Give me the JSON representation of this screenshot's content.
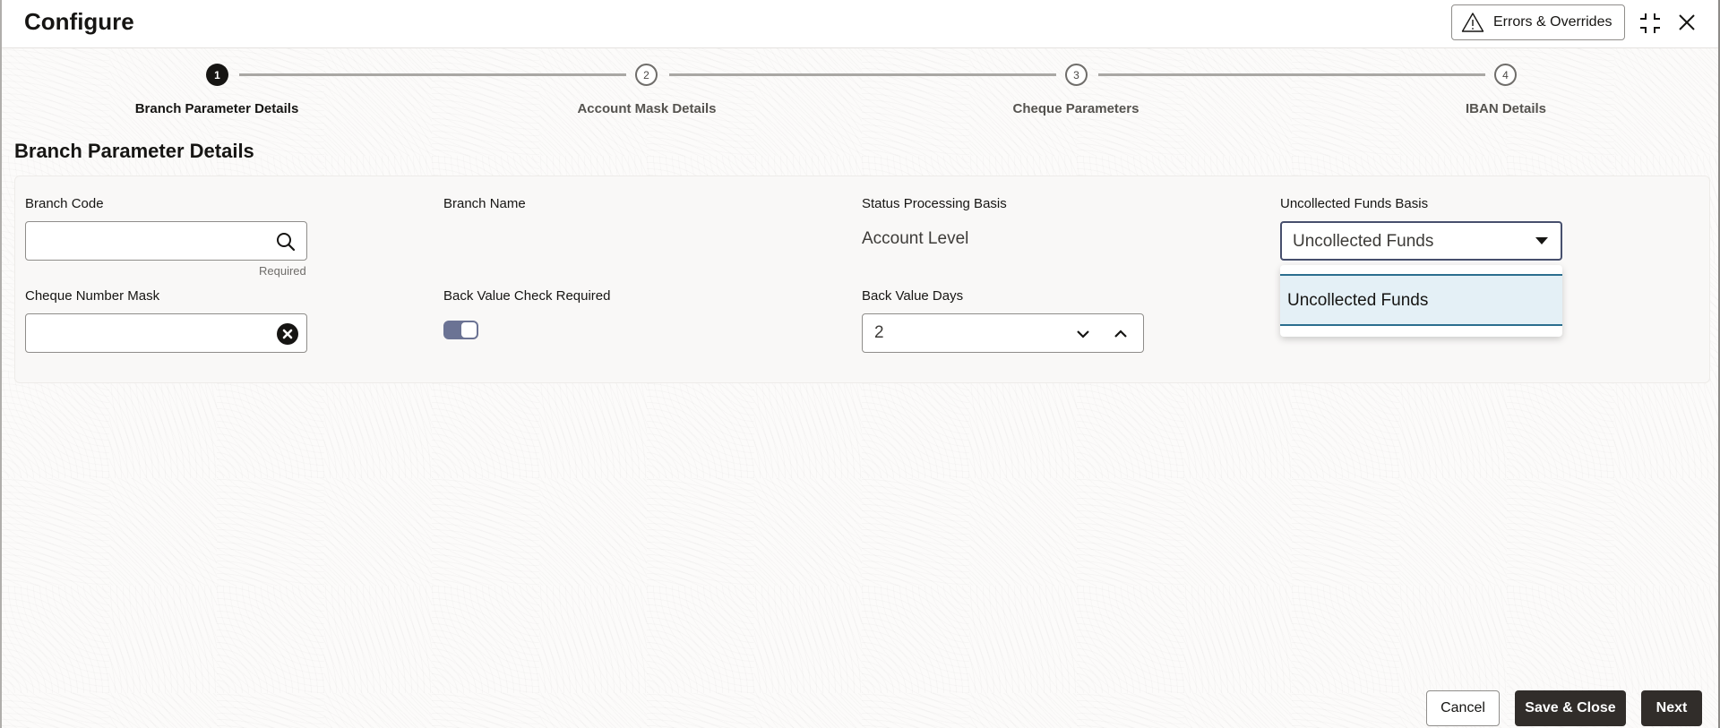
{
  "header": {
    "title": "Configure",
    "errors_button": "Errors & Overrides",
    "icons": [
      "warning-icon",
      "compress-icon",
      "close-icon"
    ]
  },
  "train": {
    "steps": [
      {
        "number": "1",
        "label": "Branch Parameter Details",
        "state": "active"
      },
      {
        "number": "2",
        "label": "Account Mask Details",
        "state": "pending"
      },
      {
        "number": "3",
        "label": "Cheque Parameters",
        "state": "pending"
      },
      {
        "number": "4",
        "label": "IBAN Details",
        "state": "pending"
      }
    ]
  },
  "section": {
    "title": "Branch Parameter Details"
  },
  "form": {
    "branch_code": {
      "label": "Branch Code",
      "value": "",
      "helper": "Required",
      "icon": "search-icon"
    },
    "branch_name": {
      "label": "Branch Name",
      "value": ""
    },
    "status_processing_basis": {
      "label": "Status Processing Basis",
      "value": "Account Level"
    },
    "uncollected_funds_basis": {
      "label": "Uncollected Funds Basis",
      "value": "Uncollected Funds",
      "options": [
        "Uncollected Funds"
      ],
      "expanded": true
    },
    "cheque_number_mask": {
      "label": "Cheque Number Mask",
      "value": "",
      "icon": "clear-icon"
    },
    "back_value_check_required": {
      "label": "Back Value Check Required",
      "checked": true
    },
    "back_value_days": {
      "label": "Back Value Days",
      "value": "2"
    }
  },
  "footer": {
    "cancel": "Cancel",
    "save_close": "Save & Close",
    "next": "Next"
  },
  "colors": {
    "primary_button": "#312d2a",
    "toggle_on": "#6b7394",
    "dropdown_highlight": "#e4f0f6",
    "dropdown_border": "#2b6e8f"
  }
}
